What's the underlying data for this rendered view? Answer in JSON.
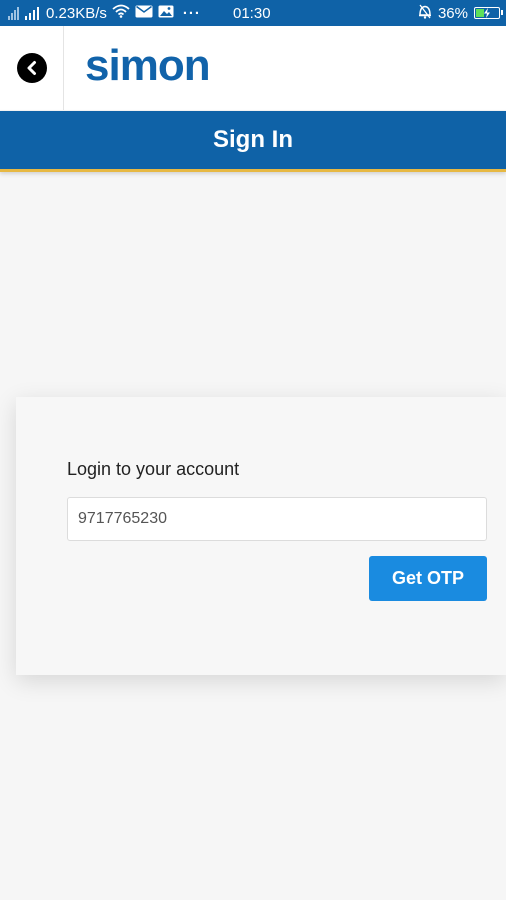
{
  "status_bar": {
    "network_speed": "0.23KB/s",
    "time": "01:30",
    "battery_percent": "36%",
    "battery_level": 0.36,
    "overflow": "···",
    "icons": [
      "signal-icon",
      "wifi-icon",
      "mail-icon",
      "image-icon",
      "alarm-icon",
      "battery-icon"
    ]
  },
  "header": {
    "logo_text": "simon",
    "back_icon": "back-arrow-icon"
  },
  "title_bar": {
    "title": "Sign In"
  },
  "login": {
    "label": "Login to your account",
    "phone_value": "9717765230",
    "otp_button_label": "Get OTP"
  },
  "colors": {
    "primary_blue": "#0f62a7",
    "accent_yellow": "#e7b842",
    "button_blue": "#1a8be0",
    "background": "#f6f6f6"
  }
}
